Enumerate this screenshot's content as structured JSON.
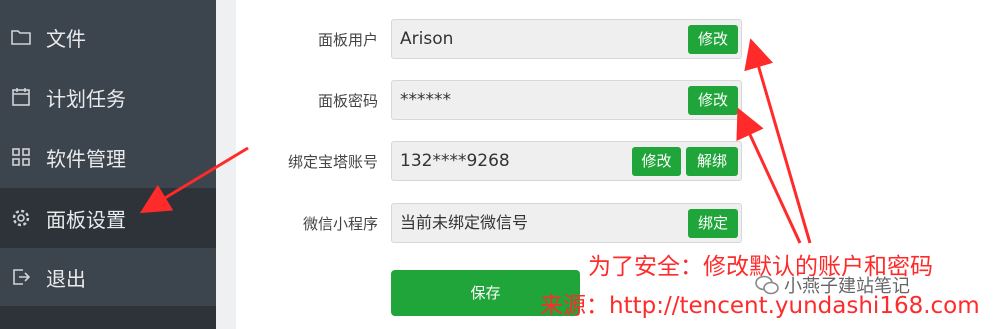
{
  "sidebar": {
    "items": [
      {
        "label": "文件",
        "icon": "folder-icon"
      },
      {
        "label": "计划任务",
        "icon": "calendar-icon"
      },
      {
        "label": "软件管理",
        "icon": "grid-icon"
      },
      {
        "label": "面板设置",
        "icon": "gear-icon"
      },
      {
        "label": "退出",
        "icon": "exit-icon"
      }
    ]
  },
  "form": {
    "panel_user": {
      "label": "面板用户",
      "value": "Arison",
      "edit_label": "修改"
    },
    "panel_password": {
      "label": "面板密码",
      "value": "******",
      "edit_label": "修改"
    },
    "bind_account": {
      "label": "绑定宝塔账号",
      "value": "132****9268",
      "edit_label": "修改",
      "unbind_label": "解绑"
    },
    "wechat_app": {
      "label": "微信小程序",
      "value": "当前未绑定微信号",
      "bind_label": "绑定"
    },
    "save_label": "保存"
  },
  "annotations": {
    "note1": "为了安全：修改默认的账户和密码",
    "note2": "来源：http://tencent.yundashi168.com",
    "watermark": "小燕子建站笔记"
  },
  "colors": {
    "sidebar_bg": "#3c444d",
    "accent_green": "#20a53a",
    "annotation_red": "#ff2a2a"
  }
}
